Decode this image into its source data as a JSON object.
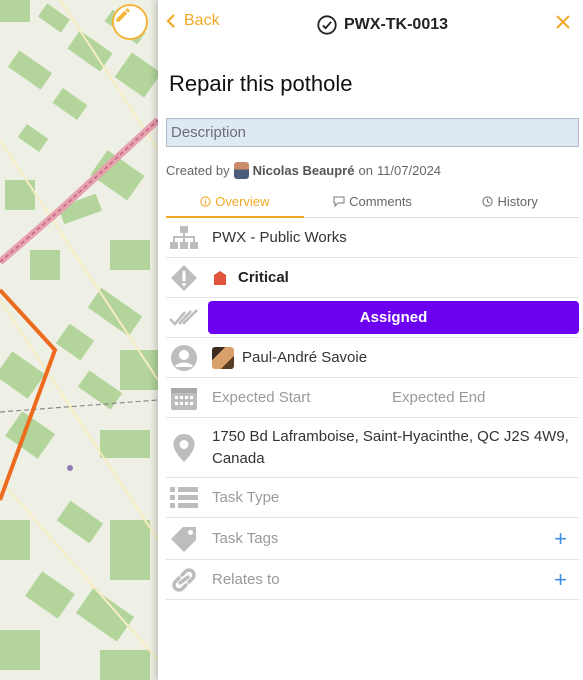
{
  "header": {
    "back_label": "Back",
    "ticket_id": "PWX-TK-0013"
  },
  "task": {
    "title": "Repair this pothole",
    "description_placeholder": "Description",
    "created_prefix": "Created by",
    "creator": "Nicolas Beaupré",
    "created_on_prefix": "on",
    "created_date": "11/07/2024"
  },
  "tabs": [
    {
      "label": "Overview",
      "icon": "info-icon",
      "active": true
    },
    {
      "label": "Comments",
      "icon": "comment-icon",
      "active": false
    },
    {
      "label": "History",
      "icon": "clock-icon",
      "active": false
    }
  ],
  "fields": {
    "organization": "PWX - Public Works",
    "priority": "Critical",
    "status": "Assigned",
    "assignee": "Paul-André Savoie",
    "expected_start": "Expected Start",
    "expected_end": "Expected End",
    "address": "1750 Bd Laframboise, Saint-Hyacinthe, QC J2S 4W9, Canada",
    "task_type": "Task Type",
    "task_tags": "Task Tags",
    "relates_to": "Relates to"
  },
  "colors": {
    "accent": "#f3a927",
    "status": "#6c00f0",
    "priority": "#e0533d",
    "link": "#3b8ee0"
  }
}
